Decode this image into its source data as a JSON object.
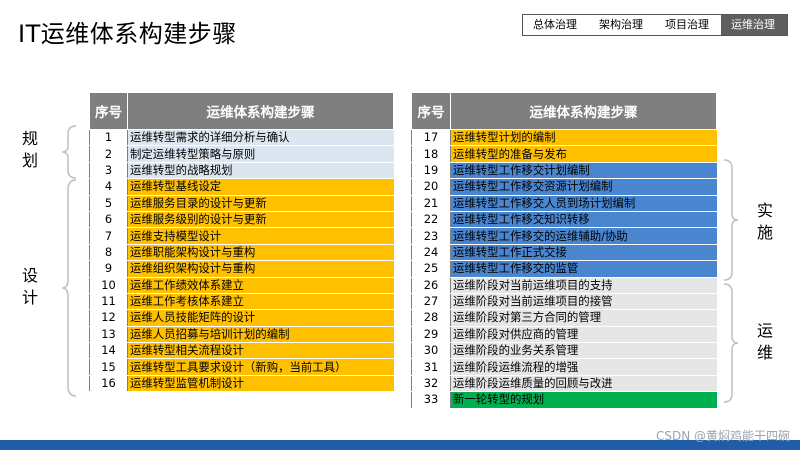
{
  "title": "IT运维体系构建步骤",
  "breadcrumb": [
    "总体治理",
    "架构治理",
    "项目治理",
    "运维治理"
  ],
  "table_headers": {
    "seq": "序号",
    "steps": "运维体系构建步骤"
  },
  "left_rows": [
    {
      "n": "1",
      "text": "运维转型需求的详细分析与确认"
    },
    {
      "n": "2",
      "text": "制定运维转型策略与原则"
    },
    {
      "n": "3",
      "text": "运维转型的战略规划"
    },
    {
      "n": "4",
      "text": "运维转型基线设定"
    },
    {
      "n": "5",
      "text": "运维服务目录的设计与更新"
    },
    {
      "n": "6",
      "text": "运维服务级别的设计与更新"
    },
    {
      "n": "7",
      "text": "运维支持模型设计"
    },
    {
      "n": "8",
      "text": "运维职能架构设计与重构"
    },
    {
      "n": "9",
      "text": "运维组织架构设计与重构"
    },
    {
      "n": "10",
      "text": "运维工作绩效体系建立"
    },
    {
      "n": "11",
      "text": "运维工作考核体系建立"
    },
    {
      "n": "12",
      "text": "运维人员技能矩阵的设计"
    },
    {
      "n": "13",
      "text": "运维人员招募与培训计划的编制"
    },
    {
      "n": "14",
      "text": "运维转型相关流程设计"
    },
    {
      "n": "15",
      "text": "运维转型工具要求设计（新购，当前工具）"
    },
    {
      "n": "16",
      "text": "运维转型监管机制设计"
    }
  ],
  "right_rows": [
    {
      "n": "17",
      "text": "运维转型计划的编制"
    },
    {
      "n": "18",
      "text": "运维转型的准备与发布"
    },
    {
      "n": "19",
      "text": "运维转型工作移交计划编制"
    },
    {
      "n": "20",
      "text": "运维转型工作移交资源计划编制"
    },
    {
      "n": "21",
      "text": "运维转型工作移交人员到场计划编制"
    },
    {
      "n": "22",
      "text": "运维转型工作移交知识转移"
    },
    {
      "n": "23",
      "text": "运维转型工作移交的运维辅助/协助"
    },
    {
      "n": "24",
      "text": "运维转型工作正式交接"
    },
    {
      "n": "25",
      "text": "运维转型工作移交的监管"
    },
    {
      "n": "26",
      "text": "运维阶段对当前运维项目的支持"
    },
    {
      "n": "27",
      "text": "运维阶段对当前运维项目的接管"
    },
    {
      "n": "28",
      "text": "运维阶段对第三方合同的管理"
    },
    {
      "n": "29",
      "text": "运维阶段对供应商的管理"
    },
    {
      "n": "30",
      "text": "运维阶段的业务关系管理"
    },
    {
      "n": "31",
      "text": "运维阶段运维流程的增强"
    },
    {
      "n": "32",
      "text": "运维阶段运维质量的回顾与改进"
    },
    {
      "n": "33",
      "text": "新一轮转型的规划"
    }
  ],
  "phases": {
    "plan": [
      "规",
      "划"
    ],
    "design": [
      "设",
      "计"
    ],
    "implement": [
      "实",
      "施"
    ],
    "operate": [
      "运",
      "维"
    ]
  },
  "watermark": "CSDN @黄焖鸡能干四碗",
  "colors": {
    "light_blue": "#dce6f1",
    "yellow": "#ffc000",
    "blue": "#4a86d0",
    "gray": "#e6e6e6",
    "green": "#00b050",
    "header": "#7f7f7f"
  }
}
